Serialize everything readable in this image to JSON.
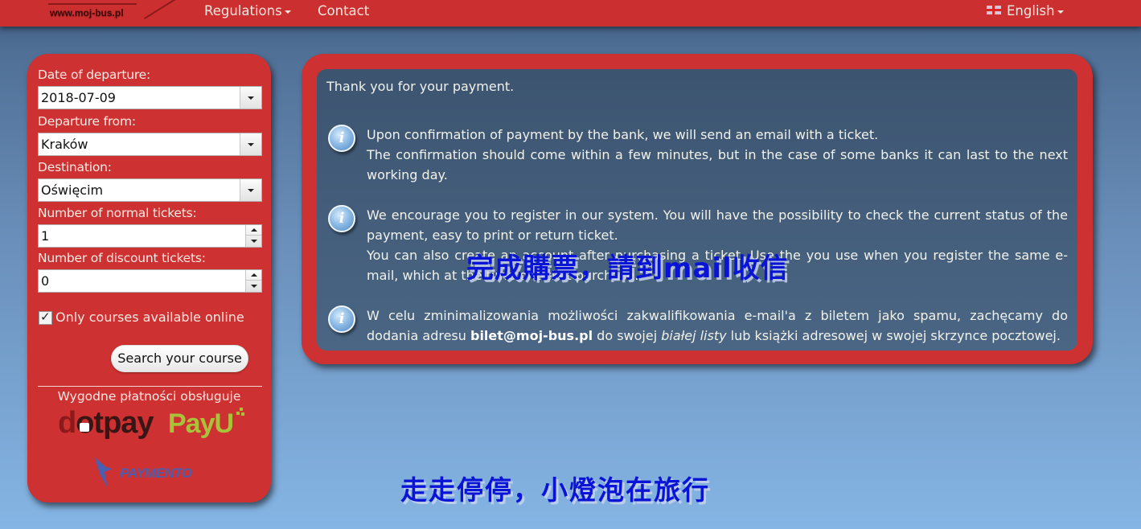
{
  "nav": {
    "logo_text": "www.moj-bus.pl",
    "items": [
      {
        "label": "Regulations",
        "has_dropdown": true
      },
      {
        "label": "Contact",
        "has_dropdown": false
      }
    ],
    "language": {
      "label": "English",
      "icon": "uk-flag-icon",
      "has_dropdown": true
    }
  },
  "search_form": {
    "date_label": "Date of departure:",
    "date_value": "2018-07-09",
    "from_label": "Departure from:",
    "from_value": "Kraków",
    "destination_label": "Destination:",
    "destination_value": "Oświęcim",
    "normal_tickets_label": "Number of normal tickets:",
    "normal_tickets_value": "1",
    "discount_tickets_label": "Number of discount tickets:",
    "discount_tickets_value": "0",
    "online_only_label": "Only courses available online",
    "online_only_checked": true,
    "checkmark_glyph": "✓",
    "search_button": "Search your course"
  },
  "payments": {
    "caption": "Wygodne płatności obsługuje",
    "providers": [
      "dotpay",
      "PayU",
      "PAYMENTO"
    ],
    "dotpay_parts": [
      "d",
      "otpay"
    ],
    "payu_text": "PayU"
  },
  "main": {
    "thanks": "Thank you for your payment.",
    "info_icon_glyph": "i",
    "blocks": [
      {
        "lines": [
          "Upon confirmation of payment by the bank, we will send an email with a ticket.",
          "The confirmation should come within a few minutes, but in the case of some banks it can last to the next working day."
        ]
      },
      {
        "lines": [
          "We encourage you to register in our system. You will have the possibility to check the current status of the payment, easy to print or return ticket.",
          "You can also create an account after purchasing a ticket. Use the you use when you register the same e-mail, which at the time of ticket purchase."
        ]
      },
      {
        "text_before": "W celu zminimalizowania możliwości zakwalifikowania e-mail'a z biletem jako spamu, zachęcamy do dodania adresu ",
        "email": "bilet@moj-bus.pl",
        "text_middle": " do swojej ",
        "italic": "białej listy",
        "text_after": " lub książki adresowej w swojej skrzynce pocztowej."
      }
    ]
  },
  "overlays": {
    "caption1": "完成購票，請到mail收信",
    "caption2": "走走停停，小燈泡在旅行"
  },
  "colors": {
    "brand_red": "#cd3131",
    "panel_blue": "#435e7c",
    "overlay_text": "#0a14d6"
  }
}
